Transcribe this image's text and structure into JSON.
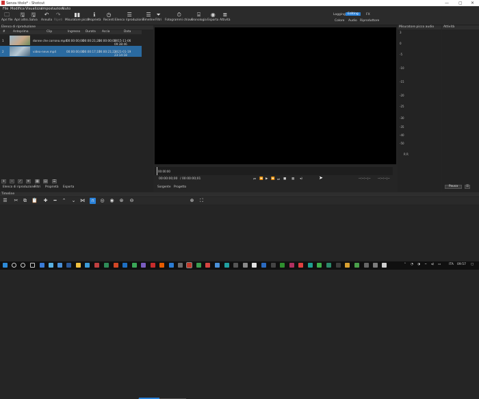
{
  "titlebar": {
    "title": "Senza titolo* - Shotcut",
    "min": "—",
    "max": "▢",
    "close": "✕"
  },
  "menu": [
    "File",
    "Modifica",
    "Visualizza",
    "Impostazioni",
    "Aiuto"
  ],
  "toolbar": {
    "open": "Apri file",
    "open_other": "Apri altro...",
    "save": "Salva",
    "undo": "Annulla",
    "redo": "Ripeti",
    "peak_meter": "Misuratore picco",
    "properties": "Proprietà",
    "recent": "Recenti",
    "playlist": "Elenco riproduzione",
    "timeline": "Timeline",
    "filters": "Filtri",
    "keyframes": "Fotogrammi chiave",
    "history": "Cronologia",
    "export": "Esporta",
    "jobs": "Attività"
  },
  "layouts": {
    "logging": "Logging",
    "editing": "Editing",
    "fx": "FX",
    "color": "Colore",
    "audio": "Audio",
    "player": "Riproduttore"
  },
  "playlist": {
    "header": "Elenco di riproduzione",
    "columns": [
      "#",
      "Anteprima",
      "Clip",
      "Ingresso",
      "Durata",
      "Accia",
      "Data"
    ],
    "rows": [
      {
        "num": "1",
        "clip": "donne che corrono.mp4",
        "in": "00:00:00;00",
        "dur": "00:00:21;23",
        "start": "00:00:00;00",
        "date": "2015-11-06 09:38:46"
      },
      {
        "num": "2",
        "clip": "video-neve.mp4",
        "in": "00:00:00;00",
        "dur": "00:00:17;17",
        "start": "00:00:21;23",
        "date": "2021-01-19 23:14:18"
      }
    ],
    "tabs": [
      "Elenco di riproduzione",
      "Filtri",
      "Proprietà",
      "Esporta"
    ],
    "btn_add": "+",
    "btn_remove": "−",
    "btn_check": "✓",
    "btn_list": "≡",
    "btn_grid1": "▦",
    "btn_grid2": "▤",
    "btn_menu": "☰"
  },
  "monitor": {
    "scrub_time": "00:00:00",
    "timecode": "00:00:00;00",
    "duration": "/ 00:00:00;01",
    "in_point": "--:--:--;--",
    "out_point": "--:--:--;--",
    "tabs": [
      "Sorgente",
      "Progetto"
    ],
    "btn_prev": "⏮",
    "btn_rew": "⏪",
    "btn_play": "▶",
    "btn_ff": "⏩",
    "btn_next": "⏭",
    "btn_stop": "■",
    "btn_grid": "▦",
    "btn_vol": "◂)"
  },
  "audio": {
    "header": "Misuratore picco audio",
    "ticks": [
      "3",
      "0",
      "-5",
      "-10",
      "-15",
      "-20",
      "-25",
      "-30",
      "-35",
      "-40",
      "-50"
    ],
    "channels": "R R"
  },
  "activity": {
    "header": "Attività",
    "pause": "Pausa",
    "menu": "☰"
  },
  "timeline": {
    "header": "Timeline"
  },
  "tray": {
    "lang": "ITA",
    "time": "09:57"
  },
  "colors": {
    "accent": "#2a82da",
    "selected_row": "#2a6aa0"
  }
}
